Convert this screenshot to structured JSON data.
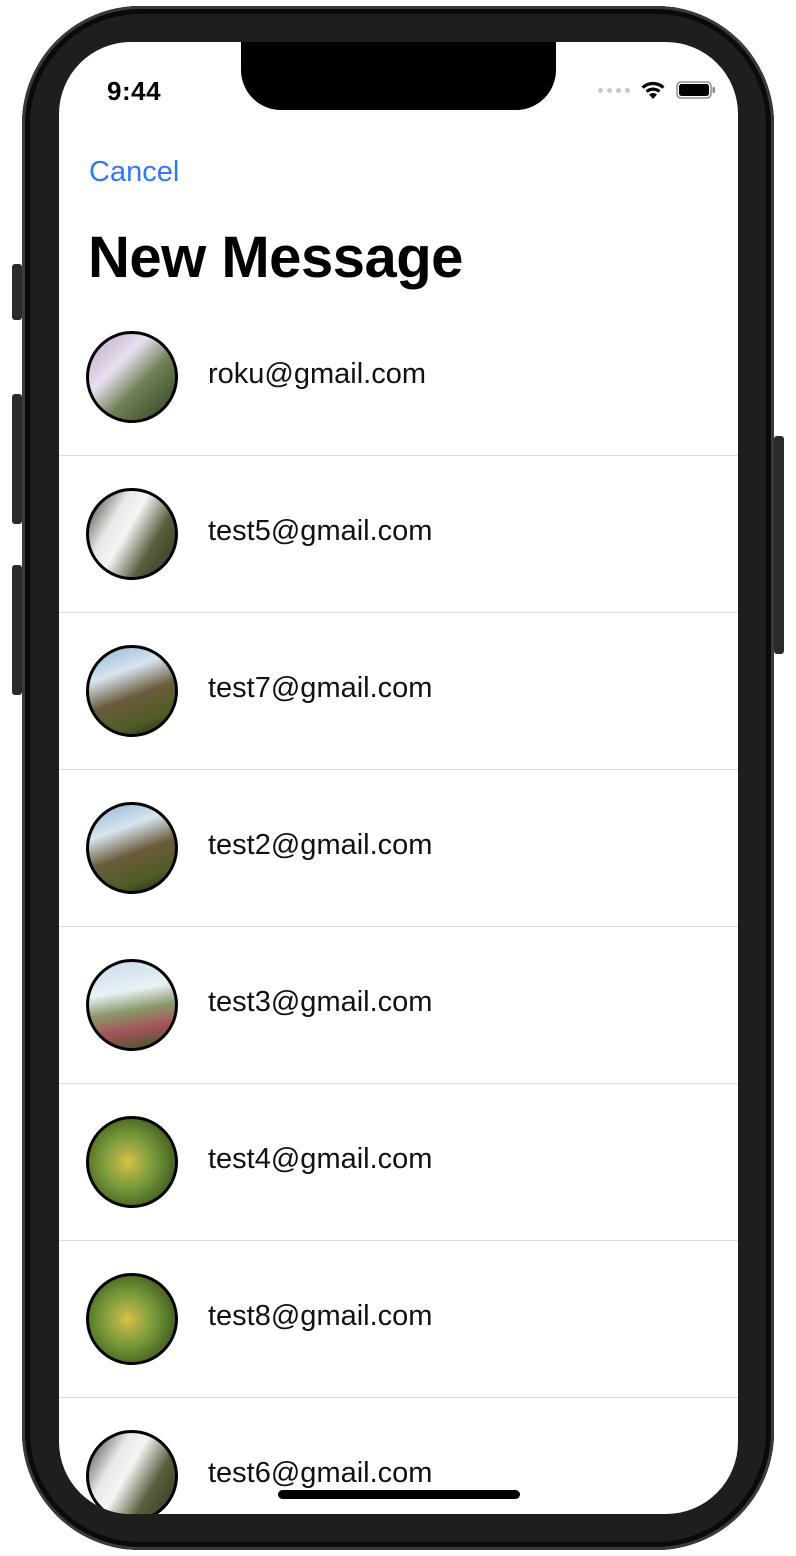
{
  "status_bar": {
    "time": "9:44",
    "signal_icon": "signal-dots-icon",
    "wifi_icon": "wifi-icon",
    "battery_icon": "battery-icon"
  },
  "nav": {
    "cancel_label": "Cancel",
    "title": "New Message"
  },
  "contacts": [
    {
      "email": "roku@gmail.com",
      "avatar": "waterfall-pink"
    },
    {
      "email": "test5@gmail.com",
      "avatar": "waterfall-white"
    },
    {
      "email": "test7@gmail.com",
      "avatar": "waterfall-cliff"
    },
    {
      "email": "test2@gmail.com",
      "avatar": "waterfall-cliff"
    },
    {
      "email": "test3@gmail.com",
      "avatar": "grass-field"
    },
    {
      "email": "test4@gmail.com",
      "avatar": "green-leaves"
    },
    {
      "email": "test8@gmail.com",
      "avatar": "green-leaves"
    },
    {
      "email": "test6@gmail.com",
      "avatar": "waterfall-white"
    }
  ],
  "colors": {
    "accent": "#3478f6",
    "separator": "#dcdcdc"
  }
}
